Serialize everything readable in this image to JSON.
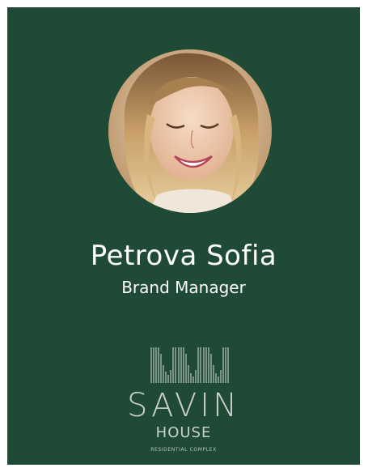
{
  "person": {
    "name": "Petrova Sofia",
    "title": "Brand Manager"
  },
  "brand": {
    "name": "SAVIN",
    "subname": "HOUSE",
    "tagline": "RESIDENTIAL COMPLEX"
  },
  "colors": {
    "card_background": "#1f4a36",
    "text": "#ffffff",
    "logo": "#c9cfd0"
  },
  "icons": {
    "avatar": "woman-portrait-photo",
    "logo_mark": "striped-building-logo"
  }
}
